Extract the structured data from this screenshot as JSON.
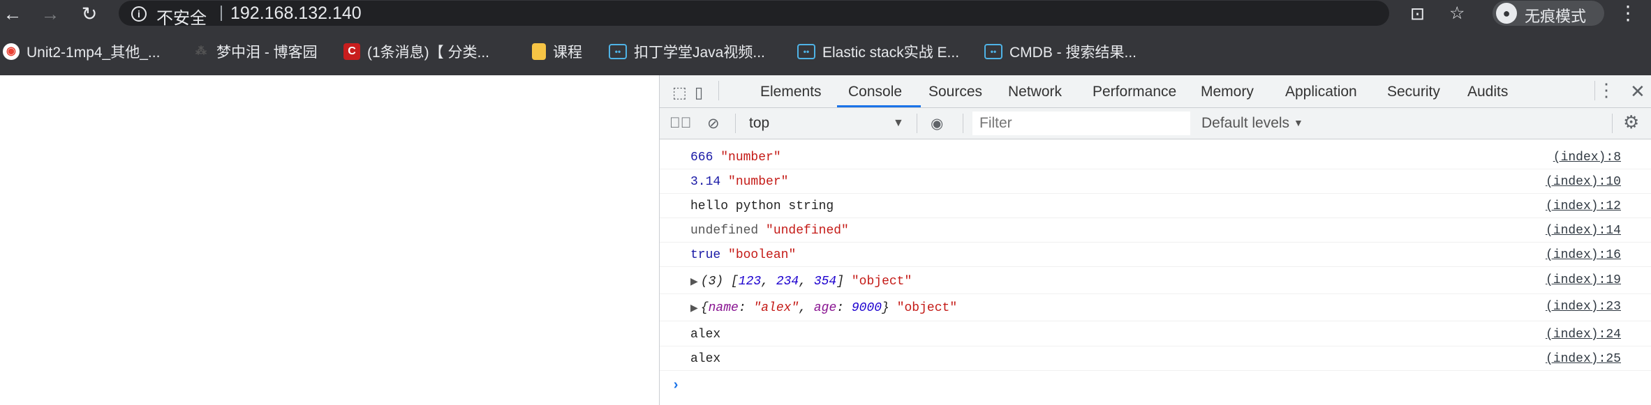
{
  "browser": {
    "security_label": "不安全",
    "url": "192.168.132.140",
    "incognito_label": "无痕模式"
  },
  "bookmarks": [
    {
      "label": "Unit2-1mp4_其他_...",
      "icon": "globe-icon"
    },
    {
      "label": "梦中泪 - 博客园",
      "icon": "blog-icon"
    },
    {
      "label": "(1条消息)【 分类...",
      "icon": "csdn-icon"
    },
    {
      "label": "课程",
      "icon": "folder-icon"
    },
    {
      "label": "扣丁学堂Java视频...",
      "icon": "bilibili-icon"
    },
    {
      "label": "Elastic stack实战 E...",
      "icon": "bilibili-icon"
    },
    {
      "label": "CMDB - 搜索结果...",
      "icon": "bilibili-icon"
    }
  ],
  "devtools": {
    "tabs": [
      "Elements",
      "Console",
      "Sources",
      "Network",
      "Performance",
      "Memory",
      "Application",
      "Security",
      "Audits"
    ],
    "active_tab": "Console",
    "context": "top",
    "filter_placeholder": "Filter",
    "levels": "Default levels"
  },
  "console": {
    "rows": [
      {
        "parts": [
          "666",
          " ",
          "\"number\""
        ],
        "source": "(index):8"
      },
      {
        "parts": [
          "3.14",
          " ",
          "\"number\""
        ],
        "source": "(index):10"
      },
      {
        "parts": [
          "hello python string"
        ],
        "source": "(index):12"
      },
      {
        "parts": [
          "undefined",
          " ",
          "\"undefined\""
        ],
        "source": "(index):14"
      },
      {
        "parts": [
          "true",
          " ",
          "\"boolean\""
        ],
        "source": "(index):16"
      },
      {
        "parts": [
          "(3) [",
          "123",
          ", ",
          "234",
          ", ",
          "354",
          "]",
          " ",
          "\"object\""
        ],
        "source": "(index):19"
      },
      {
        "parts": [
          "{",
          "name",
          ": ",
          "\"alex\"",
          ", ",
          "age",
          ": ",
          "9000",
          "}",
          " ",
          "\"object\""
        ],
        "source": "(index):23"
      },
      {
        "parts": [
          "alex"
        ],
        "source": "(index):24"
      },
      {
        "parts": [
          "alex"
        ],
        "source": "(index):25"
      }
    ]
  }
}
